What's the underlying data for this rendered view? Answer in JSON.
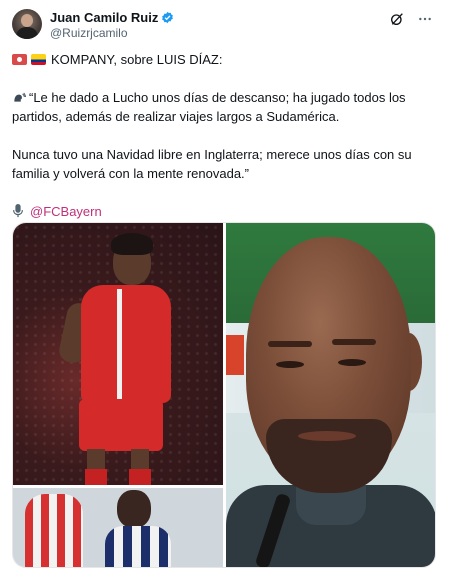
{
  "author": {
    "display_name": "Juan Camilo Ruiz",
    "handle": "@Ruizrjcamilo",
    "verified": true,
    "avatar_icon": "profile-photo"
  },
  "actions": {
    "grok_icon": "grok-icon",
    "more_icon": "more-dots-icon"
  },
  "tweet": {
    "headline": "KOMPANY, sobre LUIS DÍAZ:",
    "flags": [
      "japan-flag-icon",
      "colombia-flag-icon"
    ],
    "quote_line1": "“Le he dado a Lucho unos días de descanso; ha jugado todos los",
    "quote_line2": "partidos, además de realizar viajes largos a Sudamérica.",
    "quote_line3": "Nunca tuvo una Navidad libre en Inglaterra; merece unos días con su",
    "quote_line4": "familia y volverá con la mente renovada.”",
    "source_mention": "@FCBayern"
  },
  "colors": {
    "text": "#0f1419",
    "secondary": "#536471",
    "mention": "#c0307a",
    "verified": "#1d9bf0"
  },
  "media": {
    "count": 3,
    "images": [
      "player-photo",
      "coach-photo",
      "players-photo"
    ]
  }
}
